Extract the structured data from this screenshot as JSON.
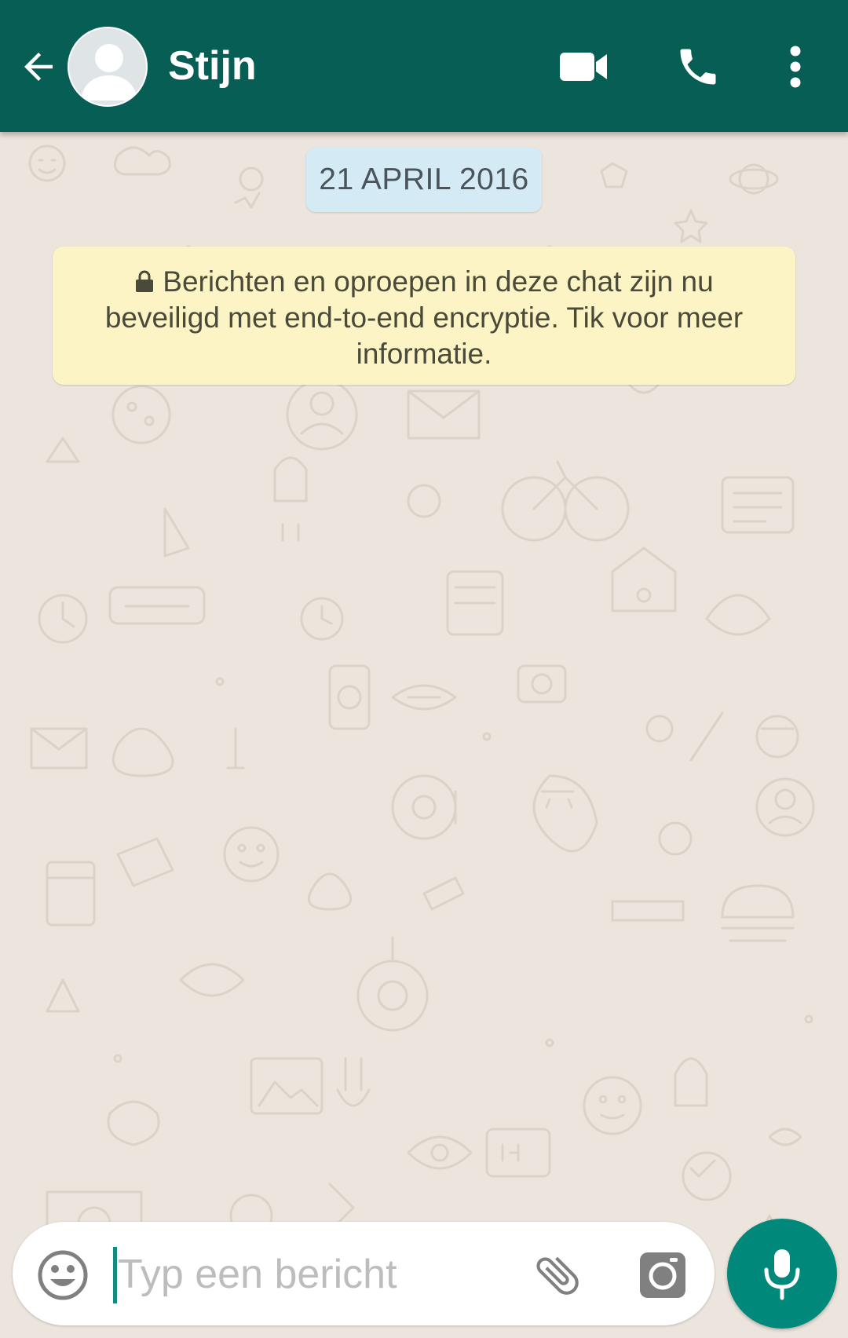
{
  "header": {
    "back_icon": "arrow-left-icon",
    "contact_name": "Stijn",
    "video_icon": "video-camera-icon",
    "call_icon": "phone-icon",
    "menu_icon": "more-vertical-icon"
  },
  "chat": {
    "date_label": "21 APRIL 2016",
    "encryption_notice": "Berichten en oproepen in deze chat zijn nu beveiligd met end-to-end encryptie. Tik voor meer informatie."
  },
  "composer": {
    "placeholder": "Typ een bericht",
    "value": ""
  },
  "colors": {
    "header": "#075E54",
    "accent": "#00897B",
    "chat_background": "#ECE5DD",
    "date_pill": "#D4EAF4",
    "notice_background": "#FCF4C4"
  }
}
